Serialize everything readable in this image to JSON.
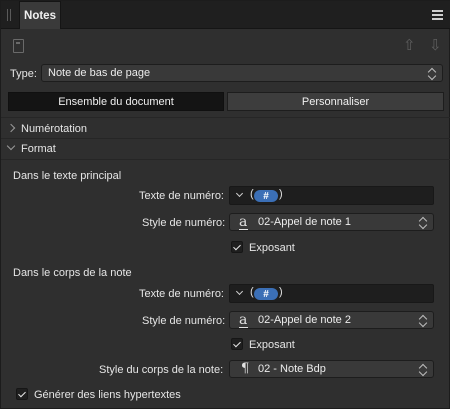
{
  "panel": {
    "tab_title": "Notes",
    "menu_icon": "hamburger-menu-icon",
    "toolbar": {
      "document_icon": "document-icon",
      "up_icon": "arrow-up-icon",
      "down_icon": "arrow-down-icon"
    }
  },
  "type_row": {
    "label": "Type:",
    "value": "Note de bas de page"
  },
  "scope": {
    "options": [
      "Ensemble du document",
      "Personnaliser"
    ],
    "selected": "Ensemble du document"
  },
  "sections": {
    "numbering": {
      "title": "Numérotation",
      "expanded": false
    },
    "format": {
      "title": "Format",
      "expanded": true
    }
  },
  "main_text": {
    "heading": "Dans le texte principal",
    "number_text_label": "Texte de numéro:",
    "number_token": "#",
    "number_style_label": "Style de numéro:",
    "number_style_value": "02-Appel de note 1",
    "superscript_label": "Exposant",
    "superscript_checked": true
  },
  "note_body": {
    "heading": "Dans le corps de la note",
    "number_text_label": "Texte de numéro:",
    "number_token": "#",
    "number_style_label": "Style de numéro:",
    "number_style_value": "02-Appel de note 2",
    "superscript_label": "Exposant",
    "superscript_checked": true,
    "body_style_label": "Style du corps de la note:",
    "body_style_value": "02 - Note Bdp"
  },
  "hyperlinks": {
    "label": "Générer des liens hypertextes",
    "checked": true
  },
  "colors": {
    "accent": "#3b6fb6",
    "panel_bg": "#2f2f2f",
    "field_bg": "#1e1e1e"
  }
}
